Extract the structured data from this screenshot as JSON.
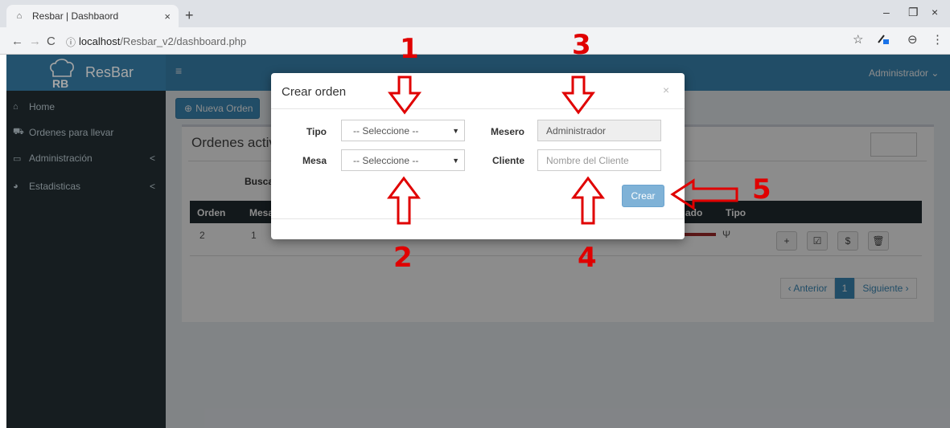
{
  "browser": {
    "tab_title": "Resbar | Dashbaord",
    "tab_close": "×",
    "new_tab": "+",
    "url_host": "localhost",
    "url_path": "/Resbar_v2/dashboard.php",
    "info_icon": "ⓘ",
    "back": "←",
    "forward": "→",
    "reload": "C",
    "star": "☆",
    "minimize": "–",
    "restore": "❐",
    "close": "×",
    "menu": "⋮",
    "profile": "⊖"
  },
  "app": {
    "brand": "ResBar",
    "logo_letters": "RB",
    "user_menu": "Administrador ⌄",
    "hamburger": "≡"
  },
  "sidebar": {
    "items": [
      {
        "label": "Home",
        "icon": "home-icon",
        "glyph": "🏠"
      },
      {
        "label": "Ordenes para llevar",
        "icon": "car-icon",
        "glyph": "🚗"
      },
      {
        "label": "Administración",
        "icon": "laptop-icon",
        "glyph": "▭",
        "chevron": "<"
      },
      {
        "label": "Estadisticas",
        "icon": "pie-chart-icon",
        "glyph": "◕",
        "chevron": "<"
      }
    ]
  },
  "main": {
    "new_order_button": "Nueva Orden",
    "new_order_plus": "⊕",
    "box_title": "Ordenes activa",
    "search_label": "Busca",
    "table": {
      "headers": [
        "Orden",
        "Mesa",
        "ado",
        "Tipo"
      ],
      "row": {
        "orden": "2",
        "mesa": "1",
        "tipo_icon": "utensils-icon",
        "tipo_glyph": "🍴"
      },
      "actions": [
        {
          "name": "add",
          "glyph": "+"
        },
        {
          "name": "edit",
          "glyph": "☑"
        },
        {
          "name": "pay",
          "glyph": "$"
        },
        {
          "name": "delete",
          "glyph": "🗑"
        }
      ]
    },
    "pagination": {
      "prev": "‹ Anterior",
      "current": "1",
      "next": "Siguiente ›"
    }
  },
  "modal": {
    "title": "Crear orden",
    "close": "×",
    "tipo_label": "Tipo",
    "tipo_value": "-- Seleccione --",
    "mesa_label": "Mesa",
    "mesa_value": "-- Seleccione --",
    "mesero_label": "Mesero",
    "mesero_value": "Administrador",
    "cliente_label": "Cliente",
    "cliente_placeholder": "Nombre del Cliente",
    "create_button": "Crear",
    "caret": "▼"
  },
  "annotations": {
    "n1": "1",
    "n2": "2",
    "n3": "3",
    "n4": "4",
    "n5": "5",
    "arrow_color": "#e00000"
  }
}
